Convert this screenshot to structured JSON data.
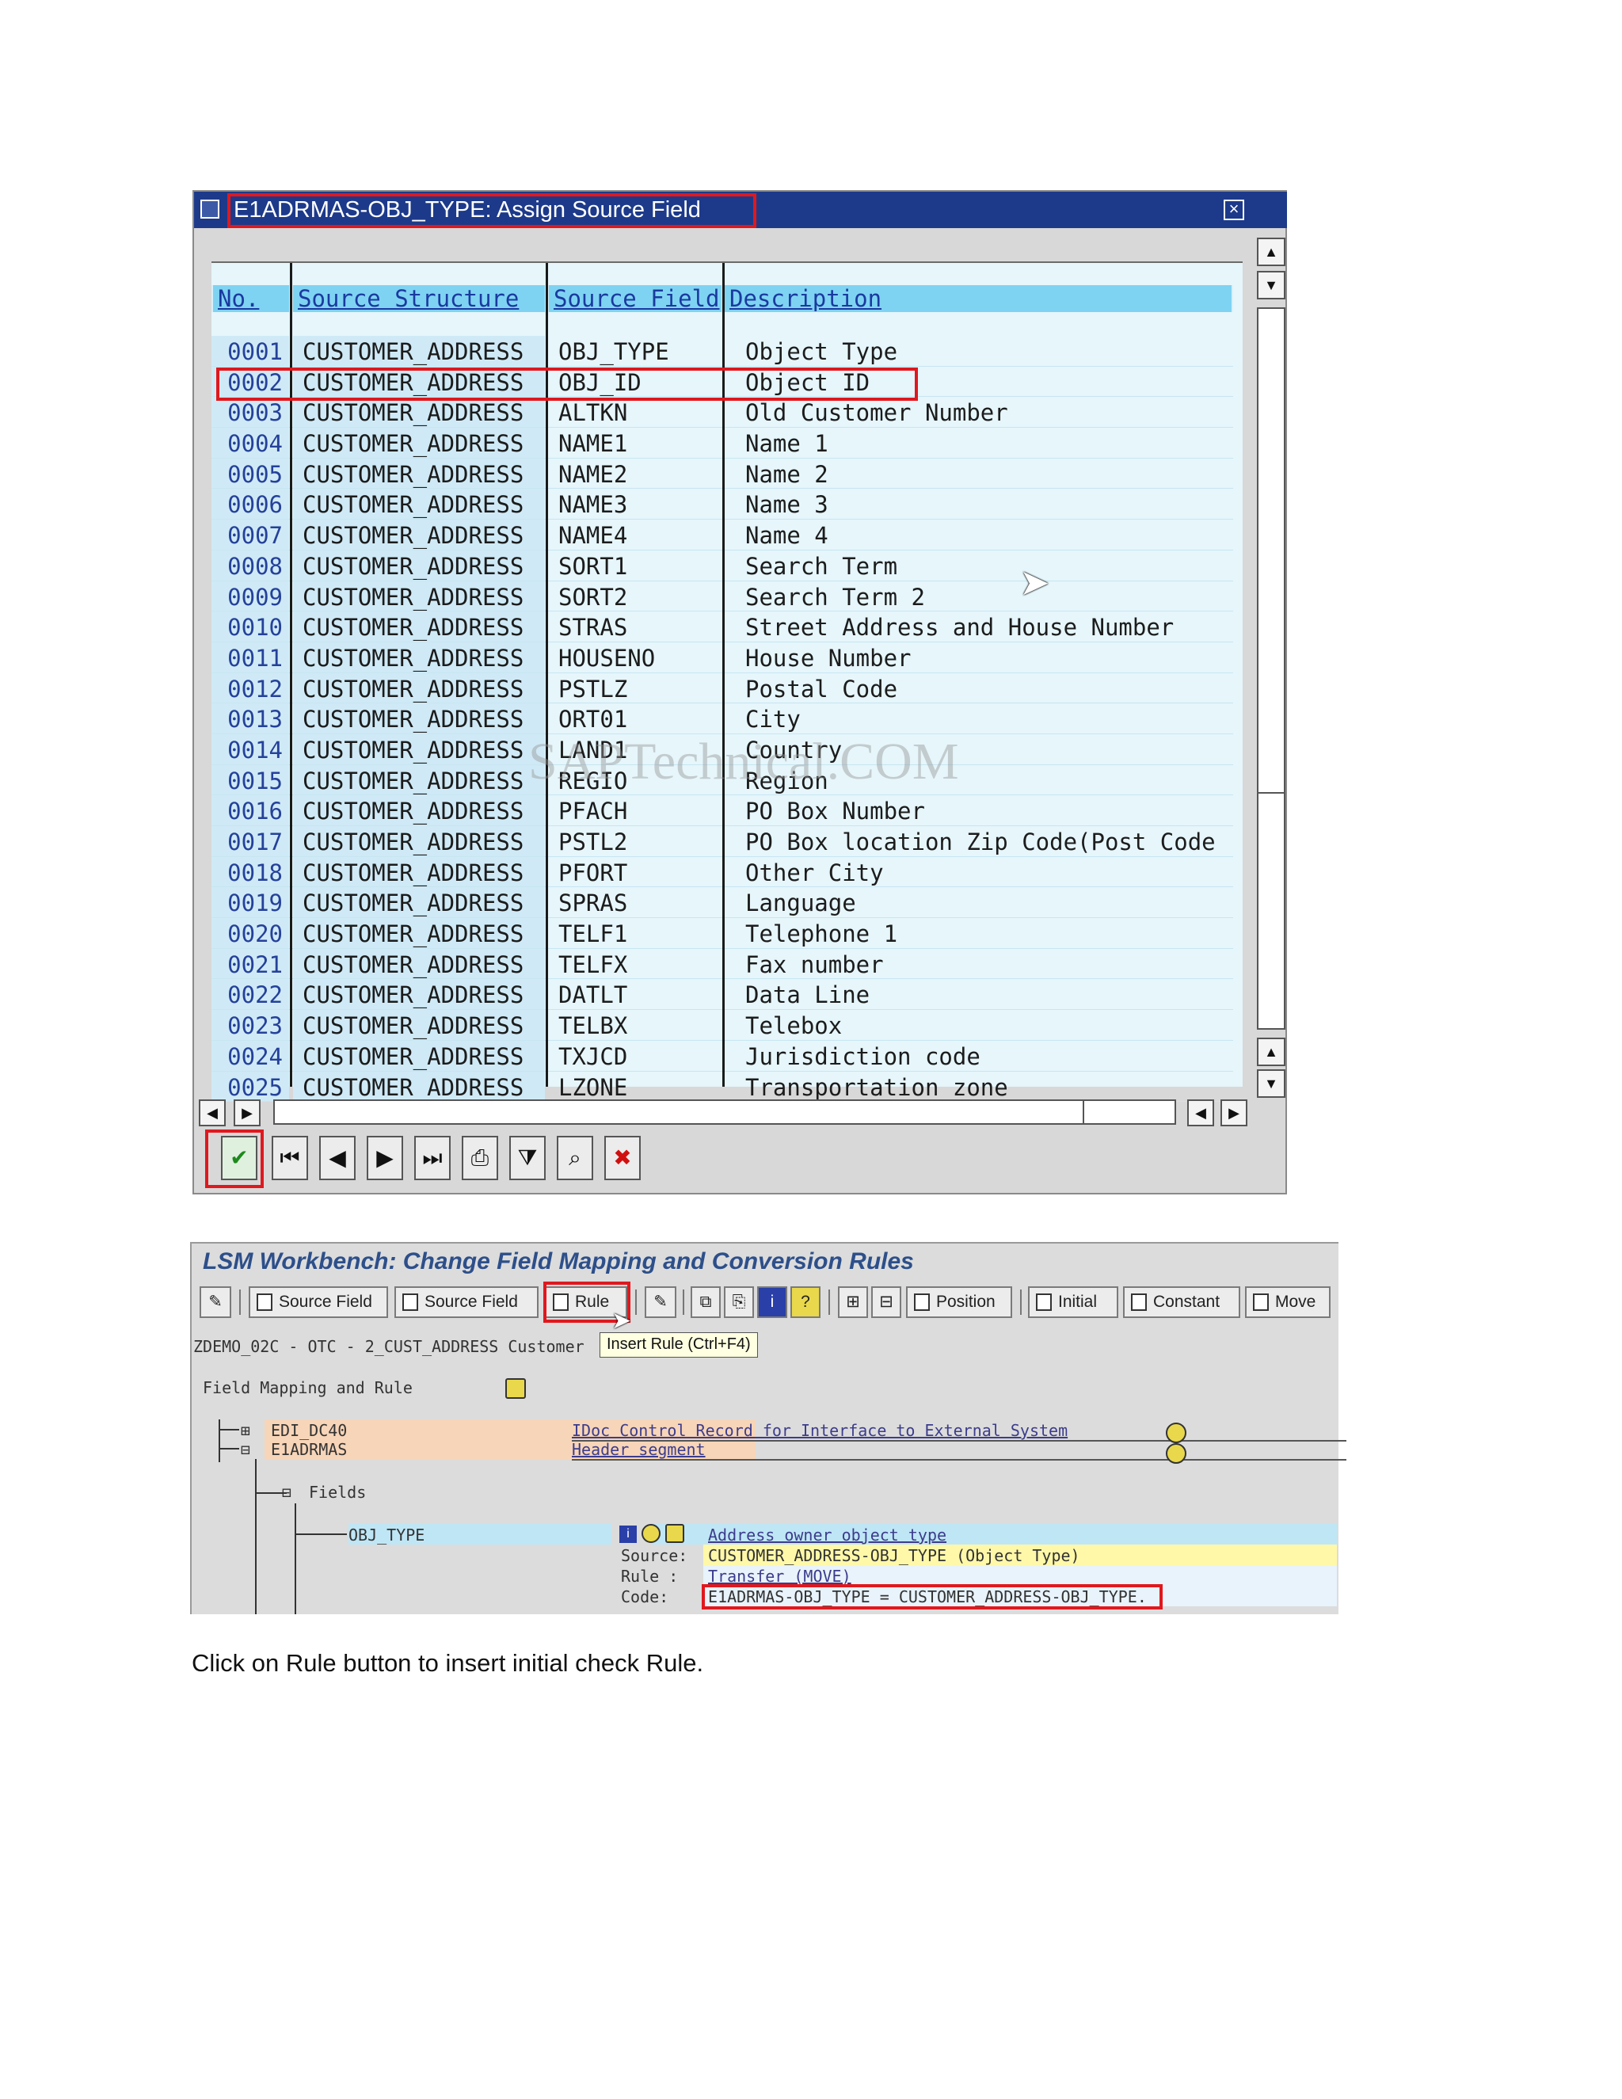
{
  "dialog": {
    "title": "E1ADRMAS-OBJ_TYPE: Assign Source Field",
    "columns": [
      "No.",
      "Source Structure",
      "Source Field",
      "Description"
    ],
    "rows": [
      [
        "0001",
        "CUSTOMER_ADDRESS",
        "OBJ_TYPE",
        "Object Type"
      ],
      [
        "0002",
        "CUSTOMER_ADDRESS",
        "OBJ_ID",
        "Object ID"
      ],
      [
        "0003",
        "CUSTOMER_ADDRESS",
        "ALTKN",
        "Old Customer Number"
      ],
      [
        "0004",
        "CUSTOMER_ADDRESS",
        "NAME1",
        "Name 1"
      ],
      [
        "0005",
        "CUSTOMER_ADDRESS",
        "NAME2",
        "Name 2"
      ],
      [
        "0006",
        "CUSTOMER_ADDRESS",
        "NAME3",
        "Name 3"
      ],
      [
        "0007",
        "CUSTOMER_ADDRESS",
        "NAME4",
        "Name 4"
      ],
      [
        "0008",
        "CUSTOMER_ADDRESS",
        "SORT1",
        "Search Term"
      ],
      [
        "0009",
        "CUSTOMER_ADDRESS",
        "SORT2",
        "Search Term 2"
      ],
      [
        "0010",
        "CUSTOMER_ADDRESS",
        "STRAS",
        "Street Address and House Number"
      ],
      [
        "0011",
        "CUSTOMER_ADDRESS",
        "HOUSENO",
        "House Number"
      ],
      [
        "0012",
        "CUSTOMER_ADDRESS",
        "PSTLZ",
        "Postal Code"
      ],
      [
        "0013",
        "CUSTOMER_ADDRESS",
        "ORT01",
        "City"
      ],
      [
        "0014",
        "CUSTOMER_ADDRESS",
        "LAND1",
        "Country"
      ],
      [
        "0015",
        "CUSTOMER_ADDRESS",
        "REGIO",
        "Region"
      ],
      [
        "0016",
        "CUSTOMER_ADDRESS",
        "PFACH",
        "PO Box Number"
      ],
      [
        "0017",
        "CUSTOMER_ADDRESS",
        "PSTL2",
        "PO Box location Zip Code(Post Code"
      ],
      [
        "0018",
        "CUSTOMER_ADDRESS",
        "PFORT",
        "Other City"
      ],
      [
        "0019",
        "CUSTOMER_ADDRESS",
        "SPRAS",
        "Language"
      ],
      [
        "0020",
        "CUSTOMER_ADDRESS",
        "TELF1",
        "Telephone 1"
      ],
      [
        "0021",
        "CUSTOMER_ADDRESS",
        "TELFX",
        "Fax number"
      ],
      [
        "0022",
        "CUSTOMER_ADDRESS",
        "DATLT",
        "Data Line"
      ],
      [
        "0023",
        "CUSTOMER_ADDRESS",
        "TELBX",
        "Telebox"
      ],
      [
        "0024",
        "CUSTOMER_ADDRESS",
        "TXJCD",
        "Jurisdiction code"
      ],
      [
        "0025",
        "CUSTOMER_ADDRESS",
        "LZONE",
        "Transportation zone"
      ]
    ],
    "watermark": "SAPTechnical.COM",
    "toolbar_icons": [
      "confirm-icon",
      "first-page-icon",
      "previous-page-icon",
      "next-page-icon",
      "last-page-icon",
      "print-icon",
      "filter-icon",
      "find-icon",
      "cancel-icon"
    ]
  },
  "lsm": {
    "title": "LSM Workbench: Change Field Mapping and Conversion Rules",
    "buttons": {
      "source_field_1": "Source Field",
      "source_field_2": "Source Field",
      "rule": "Rule",
      "position": "Position",
      "initial": "Initial",
      "constant": "Constant",
      "move": "Move"
    },
    "tooltip": "Insert Rule   (Ctrl+F4)",
    "breadcrumb": "ZDEMO_02C - OTC - 2_CUST_ADDRESS Customer",
    "section_label": "Field Mapping and Rule",
    "tree": {
      "node1": "EDI_DC40",
      "node1_desc": "IDoc Control Record for Interface to External System",
      "node2": "E1ADRMAS",
      "node2_desc": "Header segment",
      "fields": "Fields",
      "field": "OBJ_TYPE",
      "field_desc": "Address owner object type",
      "source_label": "Source:",
      "source_value": "CUSTOMER_ADDRESS-OBJ_TYPE (Object Type)",
      "rule_label": "Rule :",
      "rule_value": "Transfer (MOVE)",
      "code_label": "Code:",
      "code_value": "E1ADRMAS-OBJ_TYPE = CUSTOMER_ADDRESS-OBJ_TYPE."
    }
  },
  "caption": "Click on Rule button to insert initial check Rule.",
  "colors": {
    "title_bar": "#1d3a8a",
    "highlight": "#e0181e",
    "grid_header": "#7fd3f2",
    "grid_bg": "#e6f6fb"
  }
}
